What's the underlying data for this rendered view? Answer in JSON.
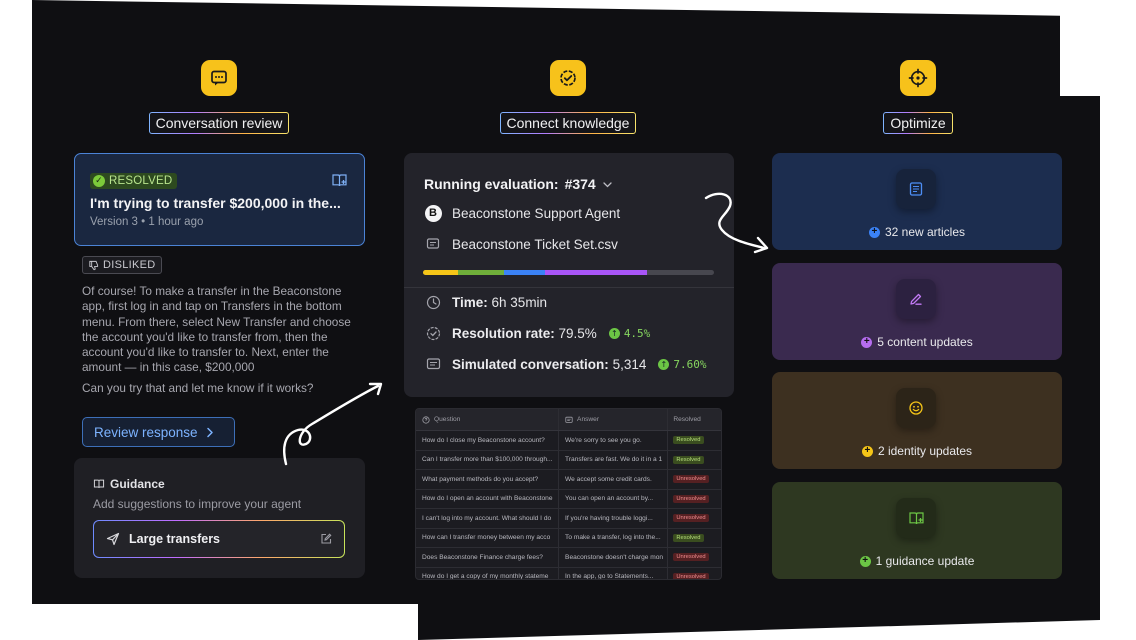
{
  "columns": {
    "review": {
      "label": "Conversation review",
      "icon": "chat-icon"
    },
    "knowledge": {
      "label": "Connect knowledge",
      "icon": "check-badge-icon"
    },
    "optimize": {
      "label": "Optimize",
      "icon": "target-icon"
    }
  },
  "conversation": {
    "status": "RESOLVED",
    "title": "I'm trying to transfer $200,000 in the...",
    "meta": "Version 3 • 1 hour ago",
    "feedback": "DISLIKED",
    "answer": "Of course! To make a transfer in the Beaconstone app, first log in and tap on Transfers in the bottom menu. From there, select New Transfer and choose the account you'd like to transfer from, then the account you'd like to transfer to. Next, enter the amount — in this case, $200,000",
    "followup": "Can you try that and let me know if it works?",
    "review_button": "Review response"
  },
  "guidance": {
    "title": "Guidance",
    "subtitle": "Add suggestions to improve your agent",
    "item": "Large transfers"
  },
  "evaluation": {
    "title": "Running evaluation:",
    "run_id": "#374",
    "agent": "Beaconstone Support Agent",
    "dataset": "Beaconstone Ticket Set.csv",
    "progress_segments": [
      {
        "color": "#f5c518",
        "fraction": 0.12
      },
      {
        "color": "#6fae3a",
        "fraction": 0.16
      },
      {
        "color": "#3b82f6",
        "fraction": 0.14
      },
      {
        "color": "#a855f7",
        "fraction": 0.35
      }
    ],
    "time_label": "Time:",
    "time_value": "6h 35min",
    "resolution_label": "Resolution rate:",
    "resolution_value": "79.5%",
    "resolution_delta": "4.5%",
    "simulated_label": "Simulated conversation:",
    "simulated_value": "5,314",
    "simulated_delta": "7.60%"
  },
  "table": {
    "headers": [
      "Question",
      "Answer",
      "Resolved"
    ],
    "rows": [
      {
        "q": "How do I close my Beaconstone account?",
        "a": "We're sorry to see you go.",
        "s": "Resolved"
      },
      {
        "q": "Can I transfer more than $100,000 through...",
        "a": "Transfers are fast. We do it in a 1",
        "s": "Resolved"
      },
      {
        "q": "What payment methods do you accept?",
        "a": "We accept some credit cards.",
        "s": "Unresolved"
      },
      {
        "q": "How do I open an account with Beaconstone",
        "a": "You can open an account by...",
        "s": "Unresolved"
      },
      {
        "q": "I can't log into my account. What should I do",
        "a": "If you're having trouble loggi...",
        "s": "Unresolved"
      },
      {
        "q": "How can I transfer money between my acco",
        "a": "To make a transfer, log into the...",
        "s": "Resolved"
      },
      {
        "q": "Does Beaconstone Finance charge fees?",
        "a": "Beaconstone doesn't charge mon",
        "s": "Unresolved"
      },
      {
        "q": "How do I get a copy of my monthly stateme",
        "a": "In the app, go to Statements...",
        "s": "Unresolved"
      }
    ]
  },
  "optimize": [
    {
      "label": "32 new articles",
      "icon": "article-icon",
      "bg": "#1c2d4f",
      "iconbg": "#17233b",
      "accent": "#3b82f6"
    },
    {
      "label": "5 content updates",
      "icon": "edit-icon",
      "bg": "#3a2a4f",
      "iconbg": "#2c2140",
      "accent": "#b66df0"
    },
    {
      "label": "2 identity updates",
      "icon": "smiley-icon",
      "bg": "#3d3020",
      "iconbg": "#2c2418",
      "accent": "#f5c518"
    },
    {
      "label": "1 guidance update",
      "icon": "guidance-book-icon",
      "bg": "#2e3821",
      "iconbg": "#232b19",
      "accent": "#6cc645"
    }
  ]
}
